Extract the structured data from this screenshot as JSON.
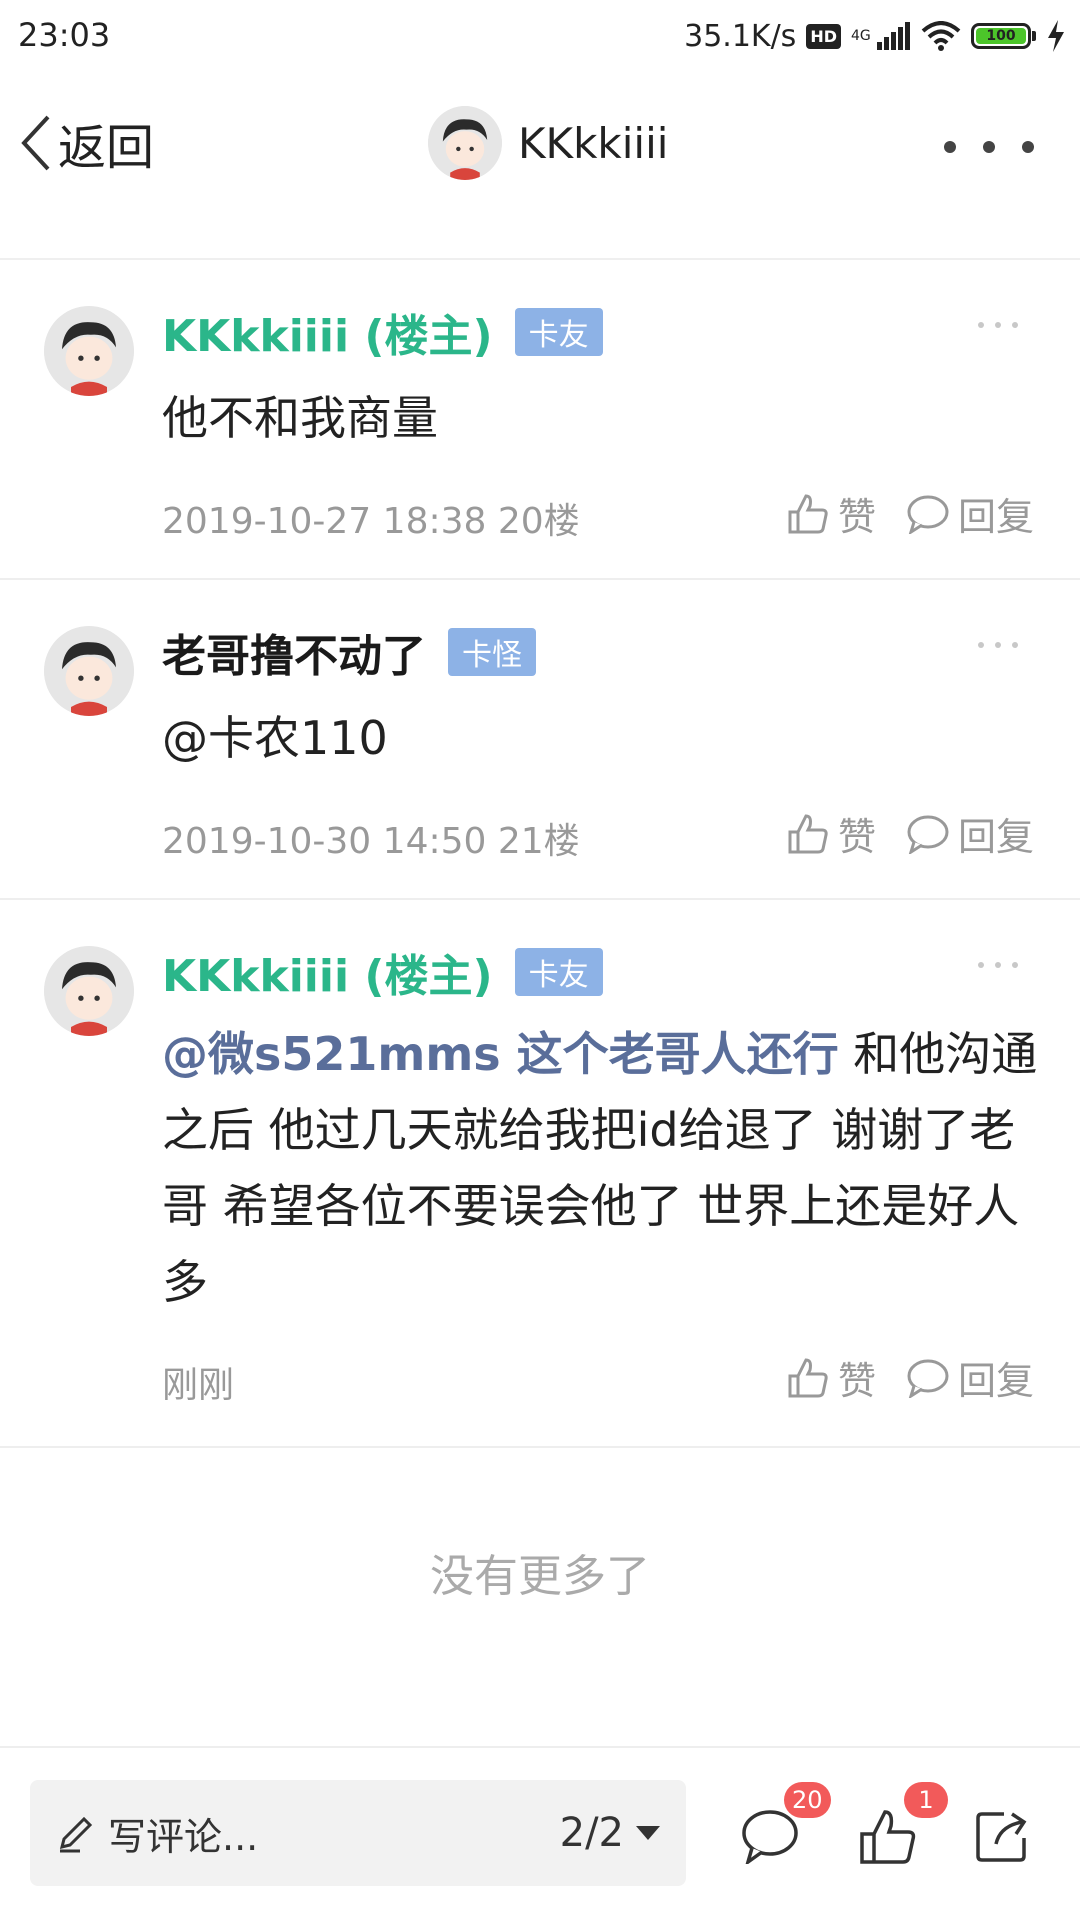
{
  "status_bar": {
    "time": "23:03",
    "network_speed": "35.1K/s",
    "hd_label": "HD",
    "network_type": "4G",
    "battery_level": "100"
  },
  "header": {
    "back_label": "返回",
    "username": "KKkkiiii"
  },
  "posts": [
    {
      "author": "KKkkiiii (楼主)",
      "badge": "卡友",
      "content": "他不和我商量",
      "meta": "2019-10-27 18:38  20楼",
      "like_label": "赞",
      "reply_label": "回复"
    },
    {
      "author": "老哥撸不动了",
      "badge": "卡怪",
      "content": "@卡农110",
      "meta": "2019-10-30 14:50  21楼",
      "like_label": "赞",
      "reply_label": "回复"
    },
    {
      "author": "KKkkiiii (楼主)",
      "badge": "卡友",
      "mention": "@微s521mms  这个老哥人还行",
      "content": " 和他沟通之后 他过几天就给我把id给退了  谢谢了老哥  希望各位不要误会他了  世界上还是好人多",
      "meta": "刚刚",
      "like_label": "赞",
      "reply_label": "回复"
    }
  ],
  "footer_text": "没有更多了",
  "bottom_bar": {
    "comment_placeholder": "写评论...",
    "page_indicator": "2/2",
    "comment_count": "20",
    "like_count": "1"
  },
  "colors": {
    "op_author": "#2bb68a",
    "badge": "#8db2e6",
    "mention": "#5a6e9a",
    "count_badge": "#f25a5a"
  }
}
